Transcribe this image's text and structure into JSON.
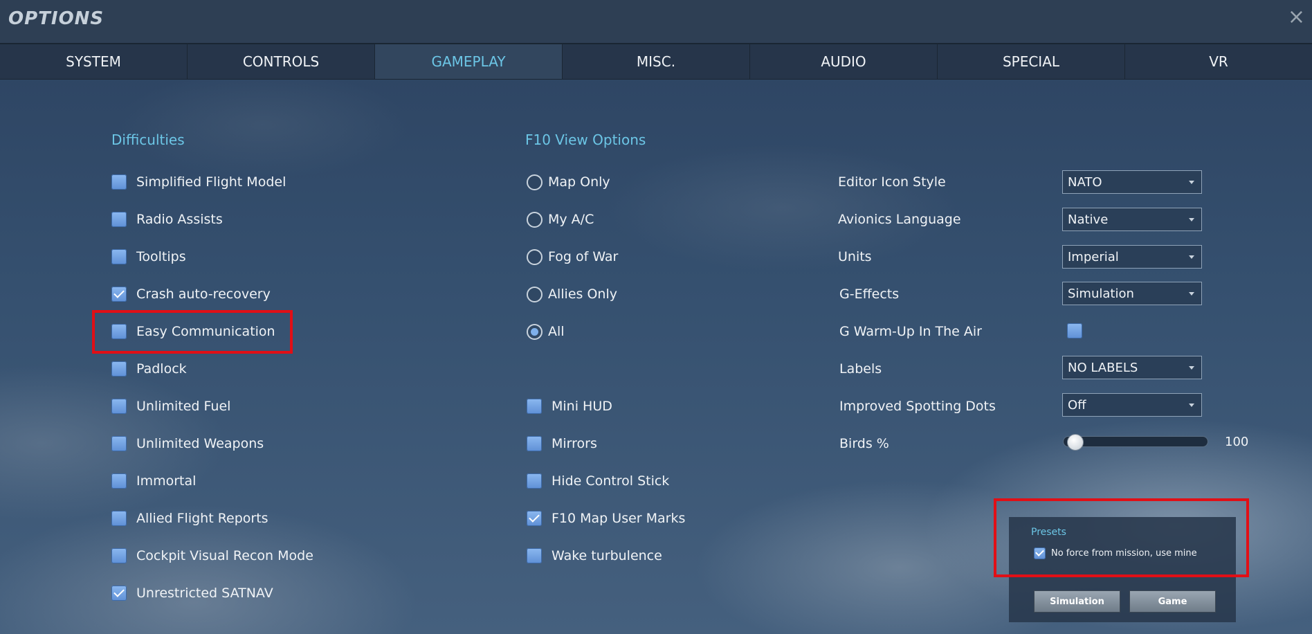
{
  "window": {
    "title": "OPTIONS",
    "close_icon": "×"
  },
  "tabs": [
    {
      "label": "SYSTEM"
    },
    {
      "label": "CONTROLS"
    },
    {
      "label": "GAMEPLAY"
    },
    {
      "label": "MISC."
    },
    {
      "label": "AUDIO"
    },
    {
      "label": "SPECIAL"
    },
    {
      "label": "VR"
    }
  ],
  "active_tab": "GAMEPLAY",
  "difficulties": {
    "title": "Difficulties",
    "items": [
      {
        "label": "Simplified Flight Model",
        "checked": false
      },
      {
        "label": "Radio Assists",
        "checked": false
      },
      {
        "label": "Tooltips",
        "checked": false
      },
      {
        "label": "Crash auto-recovery",
        "checked": true
      },
      {
        "label": "Easy Communication",
        "checked": false
      },
      {
        "label": "Padlock",
        "checked": false
      },
      {
        "label": "Unlimited Fuel",
        "checked": false
      },
      {
        "label": "Unlimited Weapons",
        "checked": false
      },
      {
        "label": "Immortal",
        "checked": false
      },
      {
        "label": "Allied Flight Reports",
        "checked": false
      },
      {
        "label": "Cockpit Visual Recon Mode",
        "checked": false
      },
      {
        "label": "Unrestricted SATNAV",
        "checked": true
      }
    ]
  },
  "f10": {
    "title": "F10 View Options",
    "radios": [
      {
        "label": "Map Only",
        "checked": false
      },
      {
        "label": "My A/C",
        "checked": false
      },
      {
        "label": "Fog of War",
        "checked": false
      },
      {
        "label": "Allies Only",
        "checked": false
      },
      {
        "label": "All",
        "checked": true
      }
    ],
    "checks": [
      {
        "label": "Mini HUD",
        "checked": false
      },
      {
        "label": "Mirrors",
        "checked": false
      },
      {
        "label": "Hide Control Stick",
        "checked": false
      },
      {
        "label": "F10 Map User Marks",
        "checked": true
      },
      {
        "label": "Wake turbulence",
        "checked": false
      }
    ]
  },
  "settings": {
    "editor_icon_style": {
      "label": "Editor Icon Style",
      "value": "NATO"
    },
    "avionics_language": {
      "label": "Avionics Language",
      "value": "Native"
    },
    "units": {
      "label": "Units",
      "value": "Imperial"
    },
    "g_effects": {
      "label": "G-Effects",
      "value": "Simulation"
    },
    "g_warmup": {
      "label": "G Warm-Up In The Air",
      "checked": false
    },
    "labels": {
      "label": "Labels",
      "value": "NO LABELS"
    },
    "spotting_dots": {
      "label": "Improved Spotting Dots",
      "value": "Off"
    },
    "birds": {
      "label": "Birds %",
      "value": "100",
      "slider_fraction": 0.0
    }
  },
  "presets": {
    "title": "Presets",
    "no_force_label": "No force from mission, use mine",
    "no_force_checked": true,
    "simulation_button": "Simulation",
    "game_button": "Game"
  },
  "colors": {
    "accent": "#6cc6e6",
    "highlight": "#e10f16",
    "checkbox": "#6fa0e0"
  }
}
